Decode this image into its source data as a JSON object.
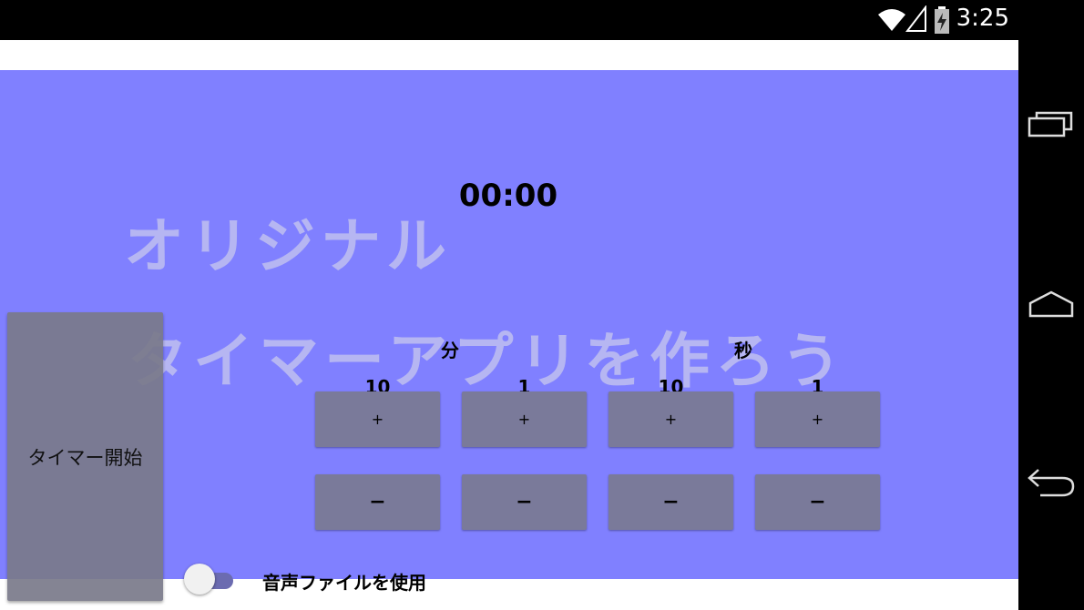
{
  "status_bar": {
    "time": "3:25",
    "icons": [
      "wifi-icon",
      "cell-signal-icon",
      "battery-charging-icon"
    ]
  },
  "background_text": {
    "line1": "オリジナル",
    "line2": "タイマーアプリを作ろう"
  },
  "timer": {
    "display": "00:00",
    "minutes_label": "分",
    "seconds_label": "秒",
    "columns": [
      {
        "step": "10",
        "plus": "+",
        "minus": "−"
      },
      {
        "step": "1",
        "plus": "+",
        "minus": "−"
      },
      {
        "step": "10",
        "plus": "+",
        "minus": "−"
      },
      {
        "step": "1",
        "plus": "+",
        "minus": "−"
      }
    ]
  },
  "start_button": {
    "label": "タイマー開始"
  },
  "sound_toggle": {
    "label": "音声ファイルを使用",
    "checked": false
  },
  "nav_bar": {
    "icons": [
      "recents-icon",
      "home-icon",
      "back-icon"
    ]
  },
  "colors": {
    "content_bg": "#8080ff",
    "button_bg": "#7a7a9a",
    "watermark_text": "#c0c0f0"
  }
}
